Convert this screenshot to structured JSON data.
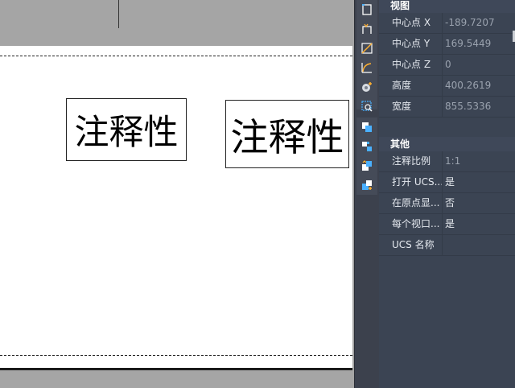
{
  "canvas": {
    "annotation_1": "注释性",
    "annotation_2": "注释性"
  },
  "toolbar": {
    "group1": [
      "select-window-icon",
      "crossing-icon",
      "line-icon",
      "arc-icon",
      "gear-plus-icon",
      "zoom-object-icon"
    ],
    "group2": [
      "copy-overlap-icon",
      "array-icon",
      "move-up-icon",
      "bring-front-icon"
    ]
  },
  "panel": {
    "view_section": "视图",
    "view_rows": [
      {
        "label": "中心点 X",
        "value": "-189.7207"
      },
      {
        "label": "中心点 Y",
        "value": "169.5449"
      },
      {
        "label": "中心点 Z",
        "value": "0"
      },
      {
        "label": "高度",
        "value": "400.2619"
      },
      {
        "label": "宽度",
        "value": "855.5336"
      }
    ],
    "other_section": "其他",
    "other_rows": [
      {
        "label": "注释比例",
        "value": "1:1"
      },
      {
        "label": "打开 UCS...",
        "value": "是"
      },
      {
        "label": "在原点显...",
        "value": "否"
      },
      {
        "label": "每个视口...",
        "value": "是"
      },
      {
        "label": "UCS 名称",
        "value": ""
      }
    ]
  }
}
